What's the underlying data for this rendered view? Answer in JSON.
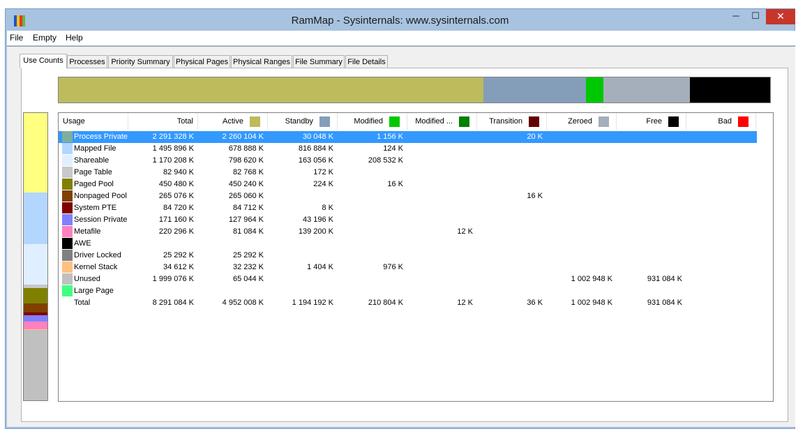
{
  "window": {
    "title": "RamMap - Sysinternals: www.sysinternals.com",
    "controls": {
      "minimize": "─",
      "maximize": "☐",
      "close": "✕"
    },
    "icon_colors": [
      "#1e55c9",
      "#f1c21b",
      "#e03a2b",
      "#6cb33f"
    ]
  },
  "menu": [
    "File",
    "Empty",
    "Help"
  ],
  "tabs": [
    {
      "label": "Use Counts",
      "active": true
    },
    {
      "label": "Processes",
      "active": false
    },
    {
      "label": "Priority Summary",
      "active": false
    },
    {
      "label": "Physical Pages",
      "active": false
    },
    {
      "label": "Physical Ranges",
      "active": false
    },
    {
      "label": "File Summary",
      "active": false
    },
    {
      "label": "File Details",
      "active": false
    }
  ],
  "overview_bar": [
    {
      "name": "Active",
      "color": "#bdbb5c",
      "fraction": 0.597
    },
    {
      "name": "Standby",
      "color": "#849eba",
      "fraction": 0.144
    },
    {
      "name": "Modified",
      "color": "#00c800",
      "fraction": 0.025
    },
    {
      "name": "Zeroed",
      "color": "#a4afbb",
      "fraction": 0.121
    },
    {
      "name": "Free",
      "color": "#000000",
      "fraction": 0.113
    }
  ],
  "side_bar": [
    {
      "name": "Process Private",
      "color": "#ffff80",
      "fraction": 0.277
    },
    {
      "name": "Mapped File",
      "color": "#b3d6ff",
      "fraction": 0.18
    },
    {
      "name": "Shareable",
      "color": "#e0efff",
      "fraction": 0.141
    },
    {
      "name": "Page Table",
      "color": "#c8c8c8",
      "fraction": 0.01
    },
    {
      "name": "Paged Pool",
      "color": "#808000",
      "fraction": 0.054
    },
    {
      "name": "Nonpaged Pool",
      "color": "#804000",
      "fraction": 0.032
    },
    {
      "name": "System PTE",
      "color": "#800000",
      "fraction": 0.01
    },
    {
      "name": "Session Private",
      "color": "#8080ff",
      "fraction": 0.021
    },
    {
      "name": "Metafile",
      "color": "#ff80c0",
      "fraction": 0.027
    },
    {
      "name": "Kernel Stack",
      "color": "#ffc080",
      "fraction": 0.004
    },
    {
      "name": "Unused",
      "color": "#c0c0c0",
      "fraction": 0.244
    }
  ],
  "table": {
    "columns": [
      {
        "label": "Usage",
        "color": null
      },
      {
        "label": "Total",
        "color": null
      },
      {
        "label": "Active",
        "color": "#bdbb5c"
      },
      {
        "label": "Standby",
        "color": "#849eba"
      },
      {
        "label": "Modified",
        "color": "#00c800"
      },
      {
        "label": "Modified ...",
        "color": "#008000"
      },
      {
        "label": "Transition",
        "color": "#640000"
      },
      {
        "label": "Zeroed",
        "color": "#a4afbb"
      },
      {
        "label": "Free",
        "color": "#000000"
      },
      {
        "label": "Bad",
        "color": "#ff0000"
      }
    ],
    "rows": [
      {
        "name": "Process Private",
        "color": "#7fae9e",
        "selected": true,
        "values": [
          "2 291 328 K",
          "2 260 104 K",
          "30 048 K",
          "1 156 K",
          "",
          "20 K",
          "",
          "",
          ""
        ]
      },
      {
        "name": "Mapped File",
        "color": "#b3d6ff",
        "selected": false,
        "values": [
          "1 495 896 K",
          "678 888 K",
          "816 884 K",
          "124 K",
          "",
          "",
          "",
          "",
          ""
        ]
      },
      {
        "name": "Shareable",
        "color": "#e0efff",
        "selected": false,
        "values": [
          "1 170 208 K",
          "798 620 K",
          "163 056 K",
          "208 532 K",
          "",
          "",
          "",
          "",
          ""
        ]
      },
      {
        "name": "Page Table",
        "color": "#c8c8c8",
        "selected": false,
        "values": [
          "82 940 K",
          "82 768 K",
          "172 K",
          "",
          "",
          "",
          "",
          "",
          ""
        ]
      },
      {
        "name": "Paged Pool",
        "color": "#808000",
        "selected": false,
        "values": [
          "450 480 K",
          "450 240 K",
          "224 K",
          "16 K",
          "",
          "",
          "",
          "",
          ""
        ]
      },
      {
        "name": "Nonpaged Pool",
        "color": "#804000",
        "selected": false,
        "values": [
          "265 076 K",
          "265 060 K",
          "",
          "",
          "",
          "16 K",
          "",
          "",
          ""
        ]
      },
      {
        "name": "System PTE",
        "color": "#800000",
        "selected": false,
        "values": [
          "84 720 K",
          "84 712 K",
          "8 K",
          "",
          "",
          "",
          "",
          "",
          ""
        ]
      },
      {
        "name": "Session Private",
        "color": "#8080ff",
        "selected": false,
        "values": [
          "171 160 K",
          "127 964 K",
          "43 196 K",
          "",
          "",
          "",
          "",
          "",
          ""
        ]
      },
      {
        "name": "Metafile",
        "color": "#ff80c0",
        "selected": false,
        "values": [
          "220 296 K",
          "81 084 K",
          "139 200 K",
          "",
          "12 K",
          "",
          "",
          "",
          ""
        ]
      },
      {
        "name": "AWE",
        "color": "#000000",
        "selected": false,
        "values": [
          "",
          "",
          "",
          "",
          "",
          "",
          "",
          "",
          ""
        ]
      },
      {
        "name": "Driver Locked",
        "color": "#808080",
        "selected": false,
        "values": [
          "25 292 K",
          "25 292 K",
          "",
          "",
          "",
          "",
          "",
          "",
          ""
        ]
      },
      {
        "name": "Kernel Stack",
        "color": "#ffc080",
        "selected": false,
        "values": [
          "34 612 K",
          "32 232 K",
          "1 404 K",
          "976 K",
          "",
          "",
          "",
          "",
          ""
        ]
      },
      {
        "name": "Unused",
        "color": "#c0c0c0",
        "selected": false,
        "values": [
          "1 999 076 K",
          "65 044 K",
          "",
          "",
          "",
          "",
          "1 002 948 K",
          "931 084 K",
          ""
        ]
      },
      {
        "name": "Large Page",
        "color": "#40ff80",
        "selected": false,
        "values": [
          "",
          "",
          "",
          "",
          "",
          "",
          "",
          "",
          ""
        ]
      },
      {
        "name": "Total",
        "color": null,
        "selected": false,
        "values": [
          "8 291 084 K",
          "4 952 008 K",
          "1 194 192 K",
          "210 804 K",
          "12 K",
          "36 K",
          "1 002 948 K",
          "931 084 K",
          ""
        ]
      }
    ]
  }
}
